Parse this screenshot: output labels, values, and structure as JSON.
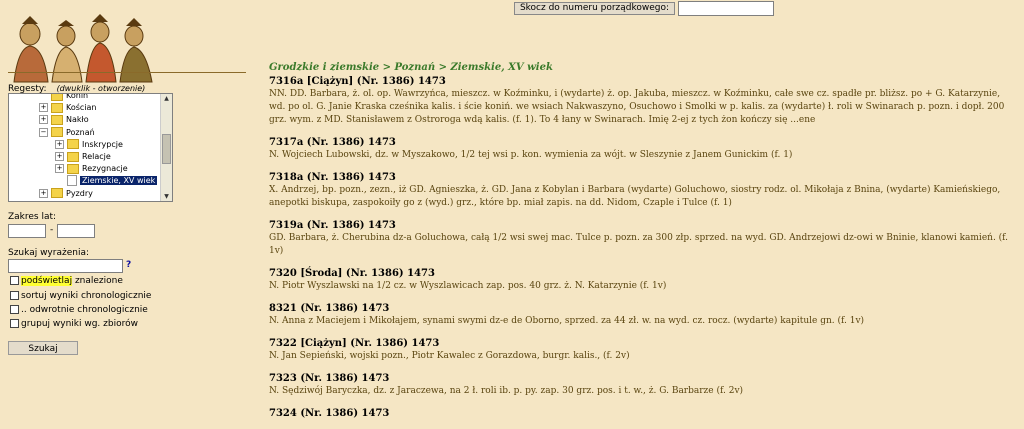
{
  "jump": {
    "button_label": "Skocz do numeru porządkowego:",
    "input_value": ""
  },
  "left": {
    "regesty_label": "Regesty:",
    "regesty_hint": "(dwuklik - otworzenie)",
    "tree": [
      {
        "label": "Konin",
        "type": "folder",
        "expander": "",
        "indent": 1
      },
      {
        "label": "Kościan",
        "type": "folder",
        "expander": "+",
        "indent": 1
      },
      {
        "label": "Nakło",
        "type": "folder",
        "expander": "+",
        "indent": 1
      },
      {
        "label": "Poznań",
        "type": "folder",
        "expander": "−",
        "indent": 1
      },
      {
        "label": "Inskrypcje",
        "type": "folder",
        "expander": "+",
        "indent": 2
      },
      {
        "label": "Relacje",
        "type": "folder",
        "expander": "+",
        "indent": 2
      },
      {
        "label": "Rezygnacje",
        "type": "folder",
        "expander": "+",
        "indent": 2
      },
      {
        "label": "Ziemskie, XV wiek",
        "type": "doc",
        "expander": "",
        "indent": 2,
        "selected": true
      },
      {
        "label": "Pyzdry",
        "type": "folder",
        "expander": "+",
        "indent": 1
      }
    ],
    "zakres_label": "Zakres lat:",
    "year_from": "",
    "year_to": "",
    "year_dash": "-",
    "szukaj_label": "Szukaj wyrażenia:",
    "search_value": "",
    "help": "?",
    "options": [
      {
        "label_hl": "podświetlaj",
        "label": " znalezione"
      },
      {
        "label_hl": "",
        "label": "sortuj wyniki chronologicznie"
      },
      {
        "label_hl": "",
        "label": ".. odwrotnie chronologicznie"
      },
      {
        "label_hl": "",
        "label": "grupuj wyniki wg. zbiorów"
      }
    ],
    "search_button": "Szukaj"
  },
  "main": {
    "breadcrumb": "Grodzkie i ziemskie > Poznań > Ziemskie, XV wiek",
    "entries": [
      {
        "title": "7316a [Ciążyn] (Nr. 1386) 1473",
        "text": "NN. DD. Barbara, ż. ol. op. Wawrzyńca, mieszcz. w Koźminku, i (wydarte) ż. op. Jakuba, mieszcz. w Koźminku, całe swe cz. spadłe pr. bliższ. po + G. Katarzynie, wd. po ol. G. Janie Kraska cześnika kalis. i ście koniń. we wsiach Nakwaszyno, Osuchowo i Smolki w p. kalis. za (wydarte) ł. roli w Swinarach p. pozn. i dopł. 200 grz. wym. z MD. Stanisławem z Ostroroga wdą kalis. (f. 1). To 4 łany w Swinarach. Imię 2-ej z tych żon kończy się ...ene"
      },
      {
        "title": "7317a (Nr. 1386) 1473",
        "text": "N. Wojciech Lubowski, dz. w Myszakowo, 1/2 tej wsi p. kon. wymienia za wójt. w Sleszynie z Janem Gunickim (f. 1)"
      },
      {
        "title": "7318a (Nr. 1386) 1473",
        "text": "X. Andrzej, bp. pozn., zezn., iż GD. Agnieszka, ż. GD. Jana z Kobylan i Barbara (wydarte) Goluchowo, siostry rodz. ol. Mikołaja z Bnina, (wydarte) Kamieńskiego, anepotki biskupa, zaspokoiły go z (wyd.) grz., które bp. miał zapis. na dd. Nidom, Czaple i Tulce (f. 1)"
      },
      {
        "title": "7319a (Nr. 1386) 1473",
        "text": "GD. Barbara, ż. Cherubina dz-a Goluchowa, całą 1/2 wsi swej mac. Tulce p. pozn. za 300 złp. sprzed. na wyd. GD. Andrzejowi dz-owi w Bninie, klanowi kamień. (f. 1v)"
      },
      {
        "title": "7320 [Środa] (Nr. 1386) 1473",
        "text": "N. Piotr Wyszlawski na 1/2 cz. w Wyszlawicach zap. pos. 40 grz. ż. N. Katarzynie (f. 1v)"
      },
      {
        "title": "8321 (Nr. 1386) 1473",
        "text": "N. Anna z Maciejem i Mikołajem, synami swymi dz-e de Oborno, sprzed. za 44 zł. w. na wyd. cz. rocz. (wydarte) kapitule gn. (f. 1v)"
      },
      {
        "title": "7322 [Ciążyn] (Nr. 1386) 1473",
        "text": "N. Jan Sepieński, wojski pozn., Piotr Kawalec z Gorazdowa, burgr. kalis., (f. 2v)"
      },
      {
        "title": "7323 (Nr. 1386) 1473",
        "text": "N. Sędziwój Baryczka, dz. z Jaraczewa, na 2 ł. roli ib. p. py. zap. 30 grz. pos. i t. w., ż. G. Barbarze (f. 2v)"
      },
      {
        "title": "7324 (Nr. 1386) 1473",
        "text": ""
      }
    ]
  }
}
